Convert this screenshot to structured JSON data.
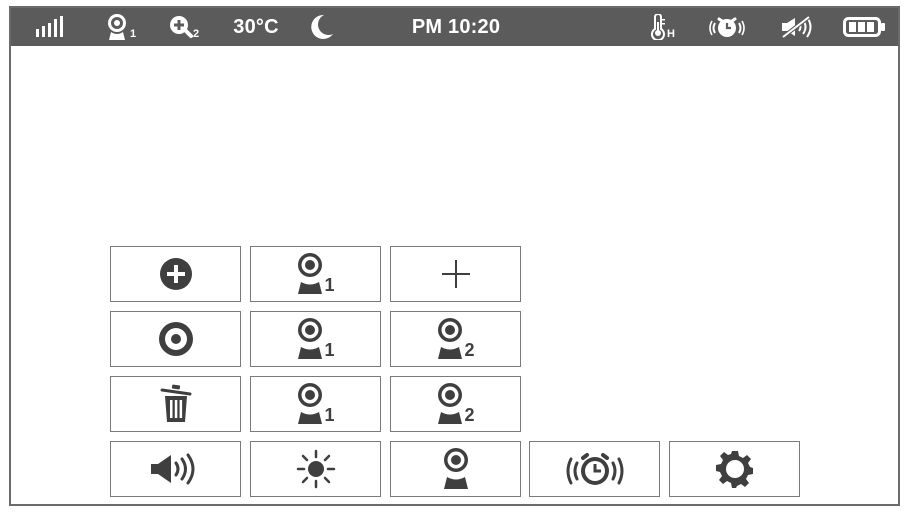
{
  "status_bar": {
    "signal_icon": "signal-bars-icon",
    "camera_icon": "camera-icon",
    "camera_number": "1",
    "zoom_icon": "zoom-in-icon",
    "zoom_level": "2",
    "temperature": "30°C",
    "night_mode_icon": "moon-icon",
    "time": "PM 10:20",
    "temp_alert_icon": "thermometer-icon",
    "temp_alert_level": "H",
    "alarm_icon": "alarm-clock-icon",
    "mute_icon": "speaker-muted-icon",
    "battery_icon": "battery-icon"
  },
  "menu": {
    "row1": {
      "zoom_icon": "zoom-in-circle-icon",
      "camera1_number": "1",
      "add_icon": "plus-icon"
    },
    "row2": {
      "record_icon": "record-icon",
      "camera1_number": "1",
      "camera2_number": "2"
    },
    "row3": {
      "delete_icon": "trash-icon",
      "camera1_number": "1",
      "camera2_number": "2"
    },
    "row4": {
      "volume_icon": "speaker-icon",
      "brightness_icon": "sun-icon",
      "camera_icon": "camera-icon",
      "alarm_icon": "alarm-clock-icon",
      "settings_icon": "gear-icon"
    }
  },
  "colors": {
    "status_bar_bg": "#5b5b5b",
    "icon_dark": "#3f3f3f",
    "border": "#7a7a7a"
  }
}
